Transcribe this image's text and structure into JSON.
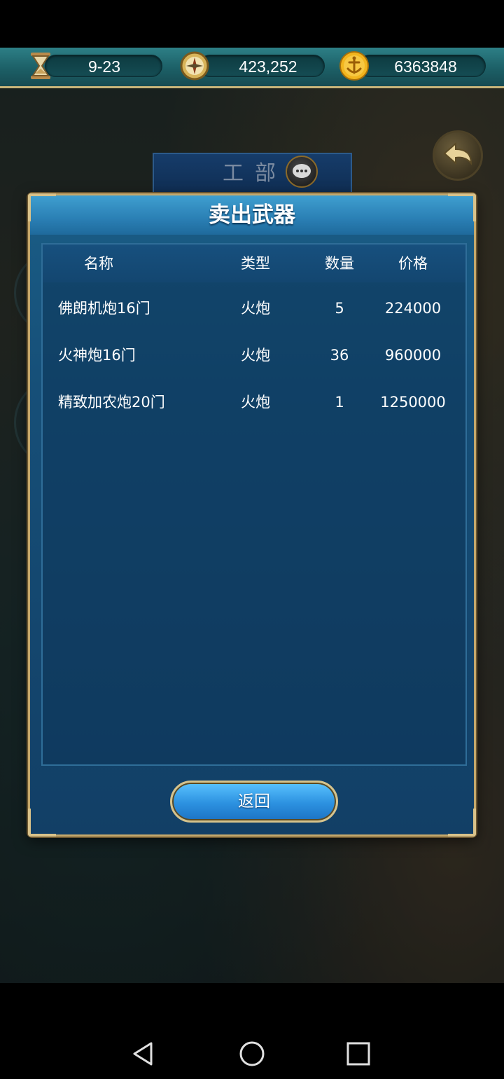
{
  "topbar": {
    "date": {
      "icon": "hourglass-icon",
      "value": "9-23"
    },
    "compass": {
      "icon": "compass-icon",
      "value": "423,252"
    },
    "gold": {
      "icon": "gold-coin-anchor-icon",
      "value": "6363848"
    }
  },
  "background": {
    "department_title": "工部",
    "back_icon": "back-arrow-icon",
    "chat_icon": "chat-bubble-icon"
  },
  "dialog": {
    "title": "卖出武器",
    "columns": [
      "名称",
      "类型",
      "数量",
      "价格"
    ],
    "rows": [
      {
        "name": "佛朗机炮16门",
        "type": "火炮",
        "quantity": "5",
        "price": "224000"
      },
      {
        "name": "火神炮16门",
        "type": "火炮",
        "quantity": "36",
        "price": "960000"
      },
      {
        "name": "精致加农炮20门",
        "type": "火炮",
        "quantity": "1",
        "price": "1250000"
      }
    ],
    "return_label": "返回"
  },
  "navbar": {
    "back": "nav-back-icon",
    "home": "nav-home-icon",
    "recents": "nav-recents-icon"
  },
  "colors": {
    "dialog_blue": "#164f78",
    "header_blue": "#2a7fb4",
    "gold_border": "#c4a86c",
    "topbar_teal": "#1c5f66"
  }
}
